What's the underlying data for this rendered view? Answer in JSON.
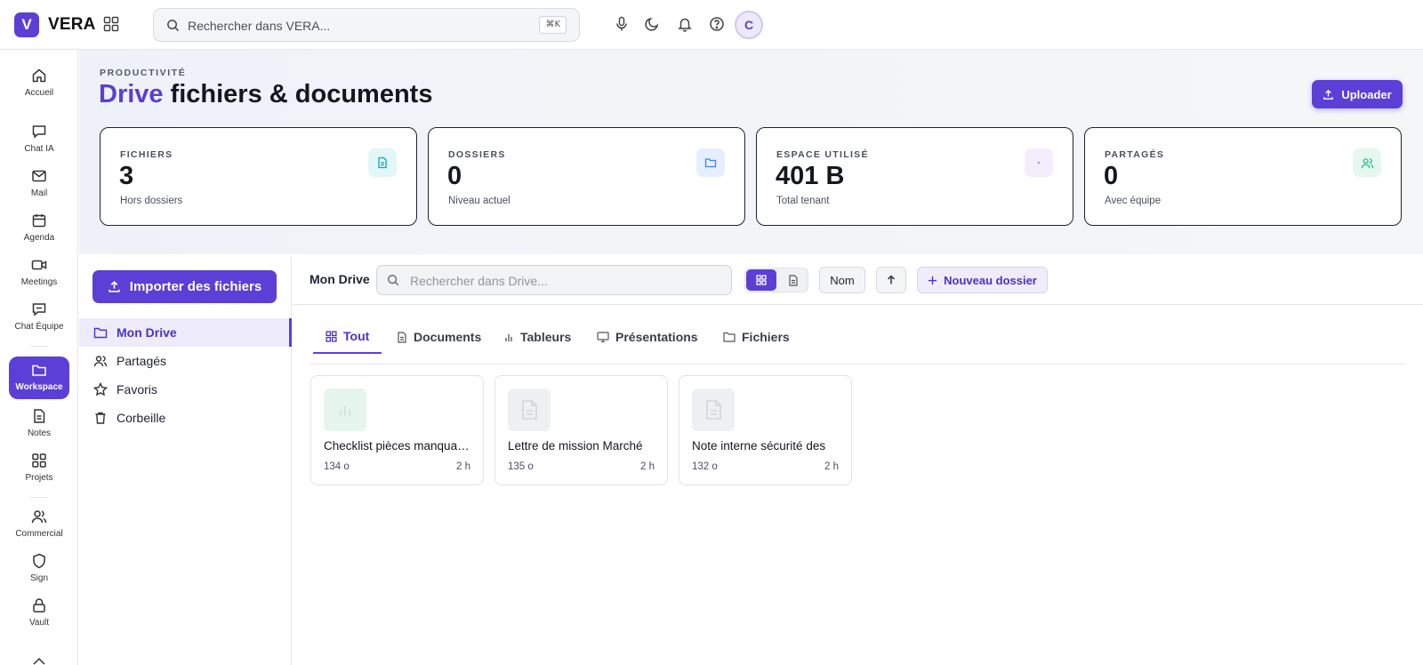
{
  "app": {
    "logo_letter": "V",
    "name": "VERA"
  },
  "topbar": {
    "search_placeholder": "Rechercher dans VERA...",
    "shortcut": "⌘K",
    "avatar_initial": "C"
  },
  "rail": {
    "items": [
      {
        "label": "Accueil",
        "icon": "home-icon"
      },
      {
        "label": "Chat IA",
        "icon": "chat-icon"
      },
      {
        "label": "Mail",
        "icon": "mail-icon"
      },
      {
        "label": "Agenda",
        "icon": "calendar-icon"
      },
      {
        "label": "Meetings",
        "icon": "video-icon"
      },
      {
        "label": "Chat Équipe",
        "icon": "team-chat-icon"
      },
      {
        "label": "Workspace",
        "icon": "folder-icon",
        "active": true
      },
      {
        "label": "Notes",
        "icon": "note-icon"
      },
      {
        "label": "Projets",
        "icon": "grid-icon"
      },
      {
        "label": "Commercial",
        "icon": "users-icon"
      },
      {
        "label": "Sign",
        "icon": "shield-icon"
      },
      {
        "label": "Vault",
        "icon": "lock-icon"
      }
    ]
  },
  "header": {
    "eyebrow": "PRODUCTIVITÉ",
    "title_accent": "Drive",
    "title_rest": "fichiers & documents",
    "upload_label": "Uploader"
  },
  "stats": [
    {
      "label": "FICHIERS",
      "value": "3",
      "sub": "Hors dossiers",
      "icon": "file-icon",
      "color": "#0ea5b7"
    },
    {
      "label": "DOSSIERS",
      "value": "0",
      "sub": "Niveau actuel",
      "icon": "folder-icon",
      "color": "#3b82f6"
    },
    {
      "label": "ESPACE UTILISÉ",
      "value": "401 B",
      "sub": "Total tenant",
      "icon": "storage-icon",
      "color": "#8b5cf6"
    },
    {
      "label": "PARTAGÉS",
      "value": "0",
      "sub": "Avec équipe",
      "icon": "users-icon",
      "color": "#10b981"
    }
  ],
  "drive_nav": {
    "import_label": "Importer des fichiers",
    "items": [
      {
        "label": "Mon Drive",
        "icon": "folder-icon",
        "active": true
      },
      {
        "label": "Partagés",
        "icon": "users-icon"
      },
      {
        "label": "Favoris",
        "icon": "star-icon"
      },
      {
        "label": "Corbeille",
        "icon": "trash-icon"
      }
    ]
  },
  "toolbar": {
    "breadcrumb": "Mon Drive",
    "search_placeholder": "Rechercher dans Drive...",
    "sort_label": "Nom",
    "new_folder_label": "Nouveau dossier"
  },
  "tabs": [
    {
      "label": "Tout",
      "icon": "grid-icon",
      "active": true
    },
    {
      "label": "Documents",
      "icon": "file-icon"
    },
    {
      "label": "Tableurs",
      "icon": "bar-chart-icon"
    },
    {
      "label": "Présentations",
      "icon": "presentation-icon"
    },
    {
      "label": "Fichiers",
      "icon": "folder-icon"
    }
  ],
  "files": [
    {
      "name": "Checklist pièces manquantes",
      "size": "134 o",
      "time": "2 h",
      "type": "spreadsheet"
    },
    {
      "name": "Lettre de mission Marché",
      "size": "135 o",
      "time": "2 h",
      "type": "document"
    },
    {
      "name": "Note interne sécurité des",
      "size": "132 o",
      "time": "2 h",
      "type": "document"
    }
  ]
}
